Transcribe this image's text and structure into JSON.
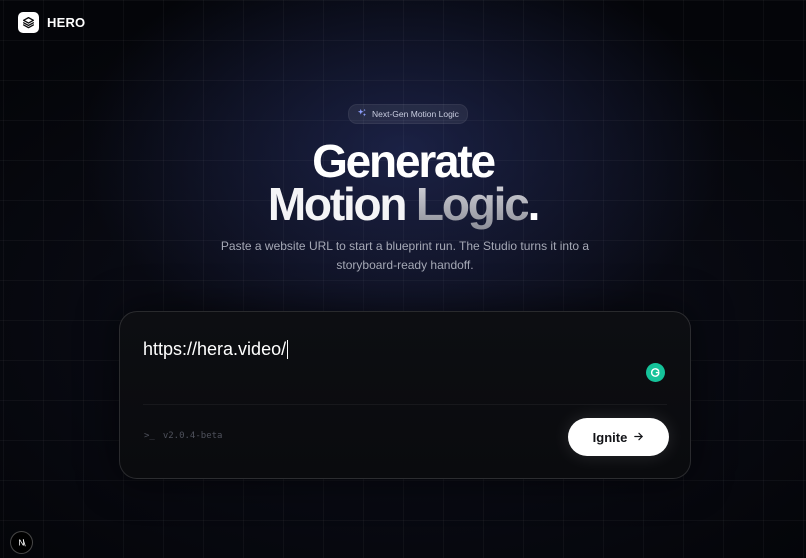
{
  "brand": {
    "name": "HERO",
    "logo_icon": "layers-icon"
  },
  "badge": {
    "icon": "sparkle-icon",
    "label": "Next-Gen Motion Logic"
  },
  "hero": {
    "line1": "Generate",
    "line2_word1": "Motion",
    "line2_word2": "Logic",
    "line2_punct": ".",
    "subtitle": "Paste a website URL to start a blueprint run. The Studio turns it into a storyboard-ready handoff."
  },
  "composer": {
    "url_value": "https://hera.video/",
    "prompt_symbol": ">_",
    "version": "v2.0.4-beta",
    "grammarly_icon": "grammarly-icon",
    "submit_label": "Ignite",
    "submit_icon": "arrow-right-icon"
  },
  "dev_indicator": {
    "letter": "N"
  },
  "colors": {
    "background": "#05060a",
    "card": "#0b0c10",
    "accent_glow": "#2a346e",
    "button_bg": "#ffffff",
    "grammarly": "#15c39a"
  }
}
